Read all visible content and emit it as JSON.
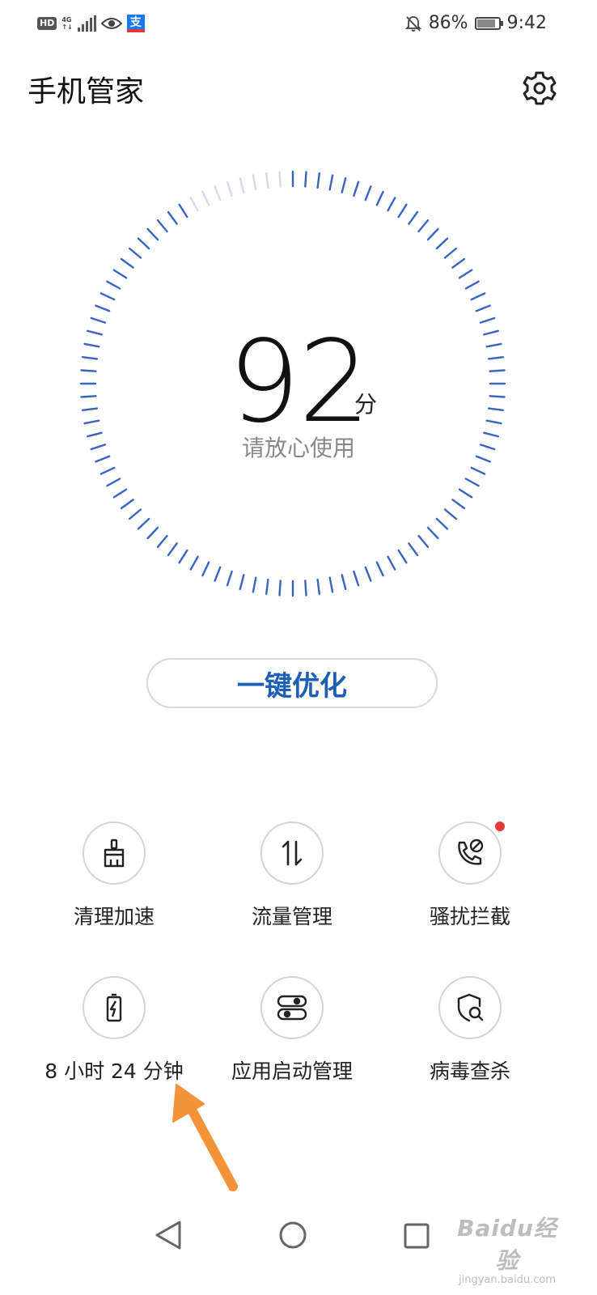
{
  "status_bar": {
    "hd": "HD",
    "network_top": "4G",
    "network_bottom": "↑↓",
    "app_badge": "支",
    "battery_percent": "86%",
    "time": "9:42",
    "battery_level": 0.86
  },
  "header": {
    "title": "手机管家"
  },
  "score": {
    "value": "92",
    "unit": "分",
    "status": "请放心使用",
    "accent_color": "#3b63c4",
    "ticks_total": 100,
    "ticks_faded": 8
  },
  "optimize_button": {
    "label": "一键优化",
    "color": "#1e5fb6"
  },
  "features": [
    {
      "label": "清理加速",
      "icon": "broom-icon"
    },
    {
      "label": "流量管理",
      "icon": "data-traffic-icon"
    },
    {
      "label": "骚扰拦截",
      "icon": "blocked-call-icon",
      "badge": true
    },
    {
      "label": "8 小时 24 分钟",
      "icon": "battery-charging-icon"
    },
    {
      "label": "应用启动管理",
      "icon": "app-launch-icon"
    },
    {
      "label": "病毒查杀",
      "icon": "shield-search-icon"
    }
  ],
  "annotation": {
    "arrow_color": "#f5933a"
  },
  "watermark": {
    "main": "Baidu经验",
    "sub": "jingyan.baidu.com"
  }
}
